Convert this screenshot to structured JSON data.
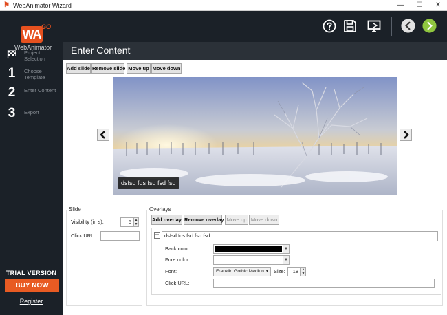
{
  "window": {
    "title": "WebAnimator Wizard",
    "minimize": "—",
    "maximize": "☐",
    "close": "✕"
  },
  "logo": {
    "mark": "WA",
    "superscript": "GO",
    "brand": "WebAnimator"
  },
  "steps": [
    {
      "icon": "checkered-flag",
      "label": "Project Selection"
    },
    {
      "num": "1",
      "label": "Choose Template"
    },
    {
      "num": "2",
      "label": "Enter Content"
    },
    {
      "num": "3",
      "label": "Export"
    }
  ],
  "trial": "TRIAL VERSION",
  "buy_now": "BUY NOW",
  "register": "Register",
  "toolbar_icons": [
    "help-icon",
    "save-icon",
    "preview-monitor-icon",
    "back-icon",
    "next-icon"
  ],
  "header": {
    "title": "Enter Content"
  },
  "slide_buttons": [
    "Add slide",
    "Remove slide",
    "Move up",
    "Move down"
  ],
  "slide": {
    "caption": "dsfsd fds fsd fsd fsd"
  },
  "slide_panel": {
    "title": "Slide",
    "visibility_label": "Visibility (in s):",
    "visibility_value": "5",
    "click_url_label": "Click URL:",
    "click_url_value": ""
  },
  "overlays": {
    "title": "Overlays",
    "buttons": [
      "Add overlay",
      "Remove overlay",
      "Move up",
      "Move down"
    ],
    "item_text": "dsfsd fds fsd fsd fsd",
    "back_color_label": "Back color:",
    "fore_color_label": "Fore color:",
    "font_label": "Font:",
    "font_value": "Franklin Gothic Mediun",
    "size_label": "Size:",
    "size_value": "18",
    "click_url_label": "Click URL:",
    "click_url_value": ""
  },
  "colors": {
    "accent": "#e85b23",
    "sidebar": "#1b2128",
    "next_button": "#8fc63f"
  }
}
